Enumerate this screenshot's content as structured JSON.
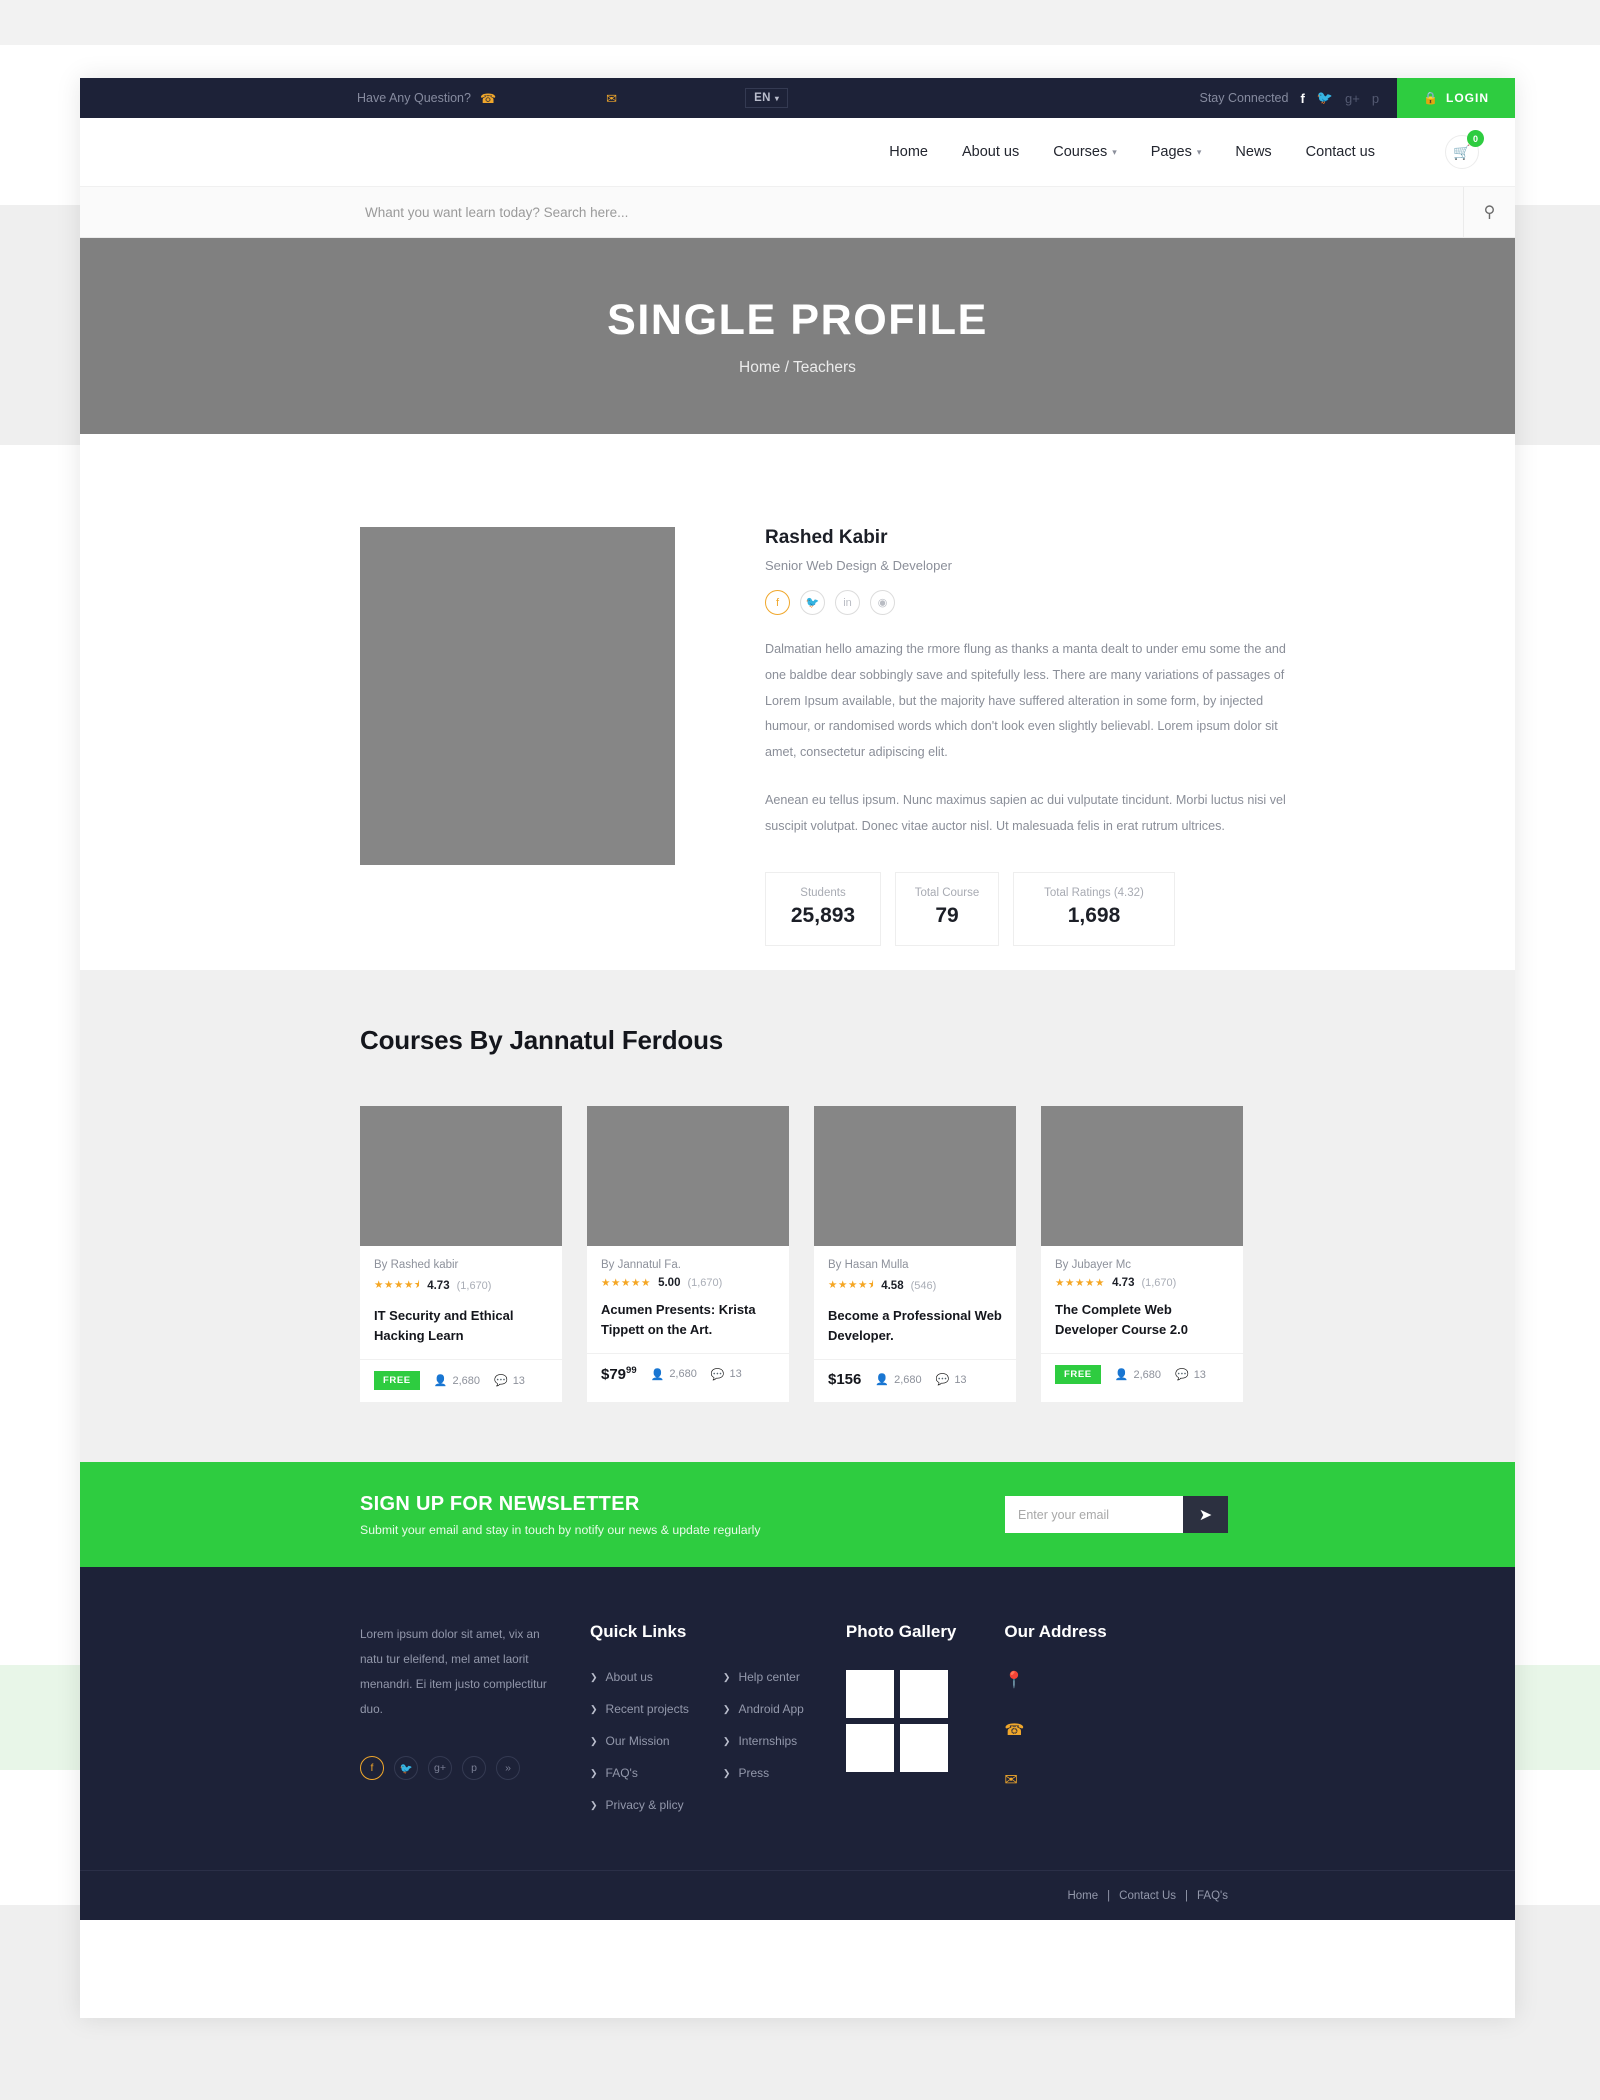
{
  "topbar": {
    "question": "Have Any Question?",
    "phone_icon": "phone-icon",
    "mail_icon": "mail-icon",
    "language": "EN",
    "caret": "▾",
    "stay_connected": "Stay Connected",
    "socials": [
      "facebook-icon",
      "twitter-icon",
      "google-plus-icon",
      "pinterest-icon"
    ],
    "login_label": "LOGIN",
    "login_icon": "lock-icon",
    "bg_color": "#1d2238",
    "accent_color": "#f0a72b",
    "login_color": "#2ecc40"
  },
  "nav": {
    "items": [
      {
        "label": "Home",
        "has_dropdown": false
      },
      {
        "label": "About us",
        "has_dropdown": false
      },
      {
        "label": "Courses",
        "has_dropdown": true
      },
      {
        "label": "Pages",
        "has_dropdown": true
      },
      {
        "label": "News",
        "has_dropdown": false
      },
      {
        "label": "Contact us",
        "has_dropdown": false
      }
    ],
    "cart_icon": "cart-icon",
    "cart_count": "0"
  },
  "search": {
    "placeholder": "Whant you want learn today? Search here...",
    "value": "",
    "icon": "search-icon"
  },
  "hero": {
    "title": "SINGLE PROFILE",
    "breadcrumb": "Home / Teachers",
    "bg_color": "#808080"
  },
  "profile": {
    "name": "Rashed Kabir",
    "role": "Senior Web Design & Developer",
    "socials": [
      {
        "icon": "facebook-icon",
        "glyph": "f",
        "active": true
      },
      {
        "icon": "twitter-icon",
        "glyph": "t",
        "active": false
      },
      {
        "icon": "linkedin-icon",
        "glyph": "in",
        "active": false
      },
      {
        "icon": "dribbble-icon",
        "glyph": "◉",
        "active": false
      }
    ],
    "bio_1": "Dalmatian hello amazing the rmore flung as thanks a manta dealt to under emu some the and one baldbe dear sobbingly save and spitefully less. There are many variations of passages of Lorem Ipsum available, but the majority have suffered alteration in some form, by injected humour, or randomised words which don't look even slightly believabl. Lorem ipsum dolor sit amet, consectetur adipiscing elit.",
    "bio_2": "Aenean eu tellus ipsum. Nunc maximus sapien ac dui vulputate tincidunt. Morbi luctus nisi vel suscipit volutpat. Donec vitae auctor nisl. Ut malesuada felis in erat rutrum ultrices.",
    "stats": [
      {
        "label": "Students",
        "value": "25,893"
      },
      {
        "label": "Total Course",
        "value": "79"
      },
      {
        "label": "Total Ratings (4.32)",
        "value": "1,698"
      }
    ]
  },
  "courses_section": {
    "title": "Courses By Jannatul Ferdous",
    "cards": [
      {
        "by": "By Rashed kabir",
        "stars": "★★★★⯨",
        "rating": "4.73",
        "rating_count": "(1,670)",
        "title": "IT Security and Ethical Hacking Learn",
        "price_type": "free",
        "price_label": "FREE",
        "students": "2,680",
        "comments": "13"
      },
      {
        "by": "By Jannatul Fa.",
        "stars": "★★★★★",
        "rating": "5.00",
        "rating_count": "(1,670)",
        "title": "Acumen Presents: Krista Tippett on the Art.",
        "price_type": "paid",
        "price_label": "$79",
        "price_cents": "99",
        "students": "2,680",
        "comments": "13"
      },
      {
        "by": "By Hasan Mulla",
        "stars": "★★★★⯨",
        "rating": "4.58",
        "rating_count": "(546)",
        "title": "Become a Professional Web Developer.",
        "price_type": "paid",
        "price_label": "$156",
        "price_cents": "",
        "students": "2,680",
        "comments": "13"
      },
      {
        "by": "By Jubayer Mc",
        "stars": "★★★★★",
        "rating": "4.73",
        "rating_count": "(1,670)",
        "title": "The Complete Web Developer Course 2.0",
        "price_type": "free",
        "price_label": "FREE",
        "students": "2,680",
        "comments": "13"
      }
    ]
  },
  "newsletter": {
    "heading": "SIGN UP FOR NEWSLETTER",
    "subheading": "Submit your email and stay in touch by notify our news & update regularly",
    "input_placeholder": "Enter your email",
    "input_value": "",
    "send_icon": "paper-plane-icon",
    "bg_color": "#2ecc40"
  },
  "footer": {
    "about_text": "Lorem ipsum dolor sit amet, vix an natu tur eleifend, mel amet laorit menandri. Ei item justo complectitur duo.",
    "socials": [
      {
        "icon": "facebook-icon",
        "glyph": "f",
        "active": true
      },
      {
        "icon": "twitter-icon",
        "glyph": "t",
        "active": false
      },
      {
        "icon": "google-plus-icon",
        "glyph": "g+",
        "active": false
      },
      {
        "icon": "pinterest-icon",
        "glyph": "p",
        "active": false
      },
      {
        "icon": "rss-icon",
        "glyph": "»",
        "active": false
      }
    ],
    "quick_links_title": "Quick Links",
    "quick_links_col1": [
      "About us",
      "Recent projects",
      "Our Mission",
      "FAQ's",
      "Privacy & plicy"
    ],
    "quick_links_col2": [
      "Help center",
      "Android App",
      "Internships",
      "Press"
    ],
    "gallery_title": "Photo Gallery",
    "gallery_count": 4,
    "address_title": "Our Address",
    "address_icons": [
      "location-pin-icon",
      "phone-icon",
      "mail-icon"
    ],
    "bottom_links": [
      "Home",
      "Contact Us",
      "FAQ's"
    ],
    "bottom_sep": "|",
    "bg_color": "#1d2238"
  }
}
